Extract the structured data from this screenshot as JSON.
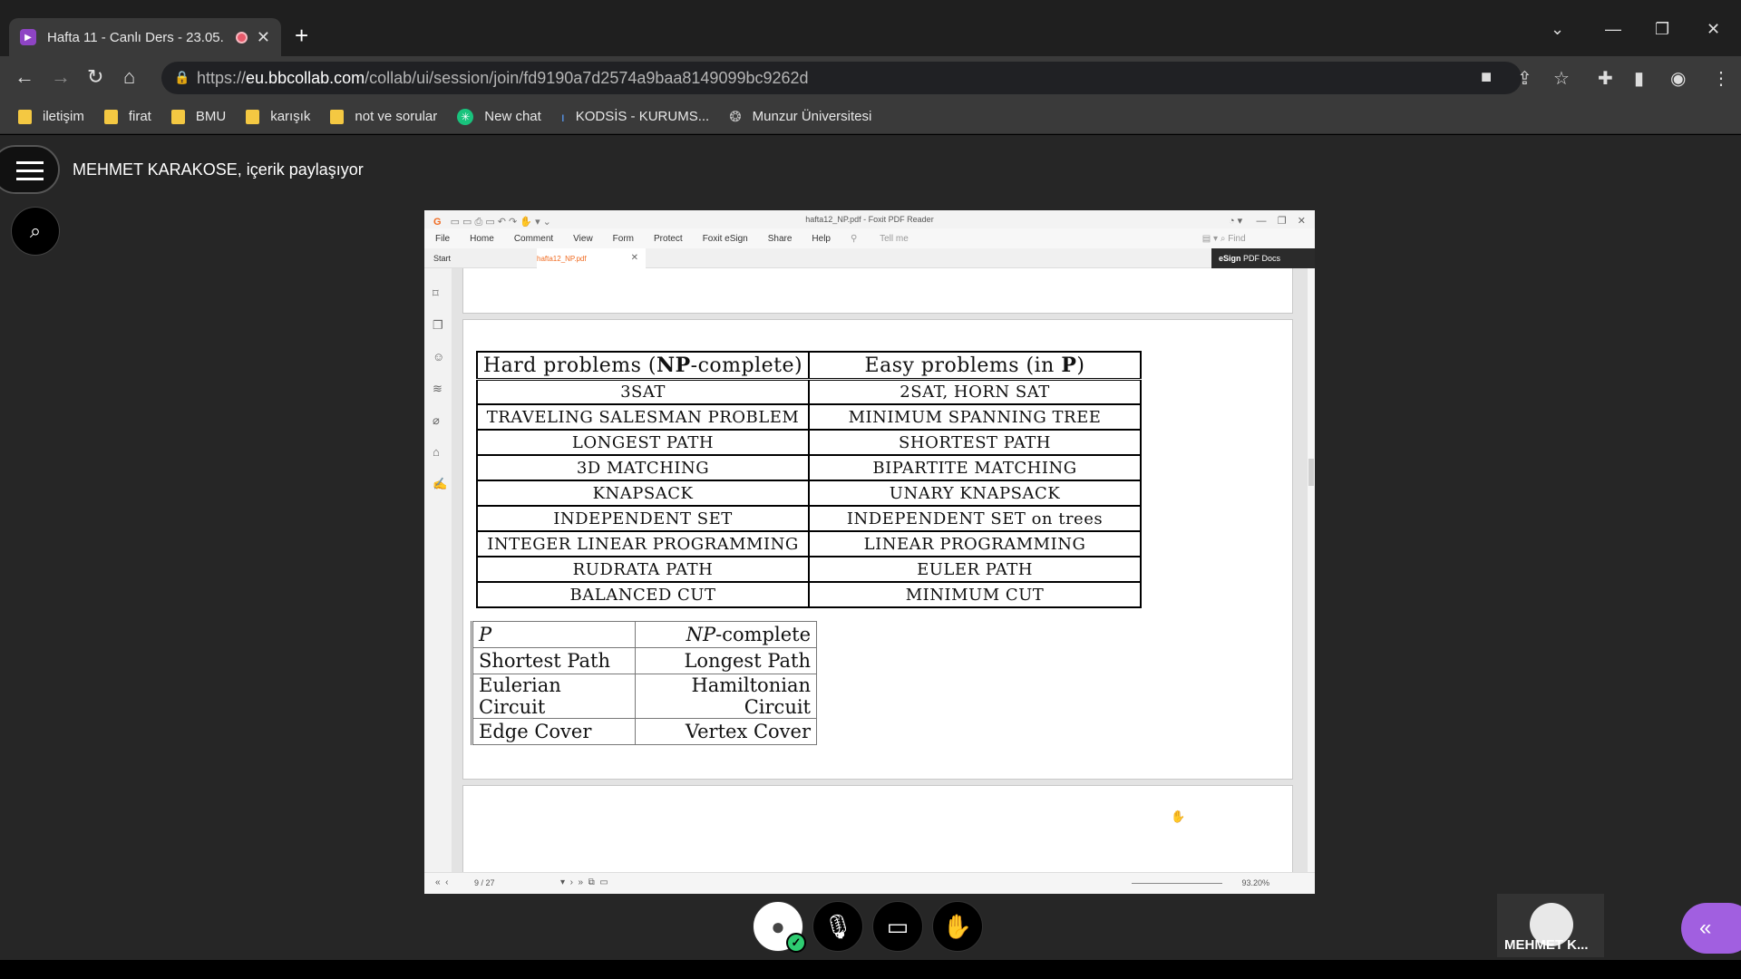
{
  "browser": {
    "tab_title": "Hafta 11 - Canlı Ders - 23.05.",
    "url_prefix": "https://",
    "url_host": "eu.bbcollab.com",
    "url_path": "/collab/ui/session/join/fd9190a7d2574a9baa8149099bc9262d",
    "bookmarks": [
      "iletişim",
      "firat",
      "BMU",
      "karışık",
      "not ve sorular",
      "New chat",
      "KODSİS - KURUMS...",
      "Munzur Üniversitesi"
    ]
  },
  "session": {
    "share_title": "MEHMET KARAKOSE, içerik paylaşıyor",
    "participant_name": "MEHMET K..."
  },
  "pdf": {
    "window_title": "hafta12_NP.pdf - Foxit PDF Reader",
    "menu": [
      "File",
      "Home",
      "Comment",
      "View",
      "Form",
      "Protect",
      "Foxit eSign",
      "Share",
      "Help"
    ],
    "tell_me": "Tell me",
    "find": "Find",
    "tab_start": "Start",
    "tab_doc": "hafta12_NP.pdf",
    "esign_label": "eSign",
    "esign_suffix": "PDF Docs",
    "page_indicator": "9 / 27",
    "zoom": "93.20%",
    "table1": {
      "headers": [
        "Hard problems (NP-complete)",
        "Easy problems (in P)"
      ],
      "rows": [
        [
          "3SAT",
          "2SAT, HORN SAT"
        ],
        [
          "TRAVELING SALESMAN PROBLEM",
          "MINIMUM SPANNING TREE"
        ],
        [
          "LONGEST PATH",
          "SHORTEST PATH"
        ],
        [
          "3D MATCHING",
          "BIPARTITE MATCHING"
        ],
        [
          "KNAPSACK",
          "UNARY KNAPSACK"
        ],
        [
          "INDEPENDENT SET",
          "INDEPENDENT SET on trees"
        ],
        [
          "INTEGER LINEAR PROGRAMMING",
          "LINEAR PROGRAMMING"
        ],
        [
          "RUDRATA PATH",
          "EULER PATH"
        ],
        [
          "BALANCED CUT",
          "MINIMUM CUT"
        ]
      ]
    },
    "table2": {
      "headers": [
        "P",
        "NP-complete"
      ],
      "rows": [
        [
          "Shortest Path",
          "Longest Path"
        ],
        [
          "Eulerian Circuit",
          "Hamiltonian Circuit"
        ],
        [
          "Edge Cover",
          "Vertex Cover"
        ]
      ]
    }
  },
  "colors": {
    "accent_purple": "#a15fe0",
    "ok_green": "#2ecc71",
    "foxit_orange": "#f06b21"
  }
}
